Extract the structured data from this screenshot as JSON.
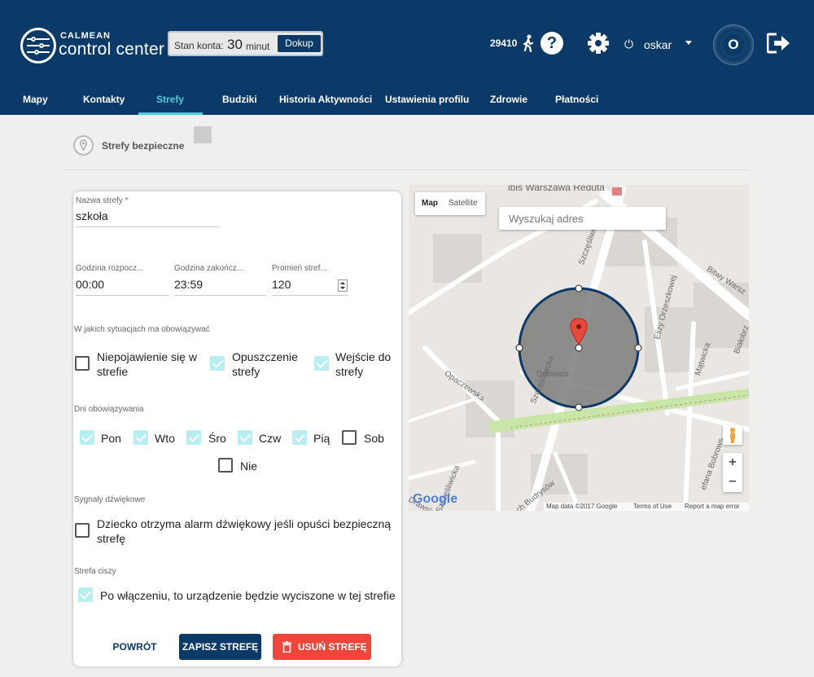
{
  "header": {
    "brand_top": "CALMEAN",
    "brand_main": "control center",
    "account_label": "Stan konta:",
    "account_value": "30",
    "account_unit": "minut",
    "topup_label": "Dokup",
    "steps": "29410",
    "user_name": "oskar",
    "avatar_letter": "O",
    "colors": {
      "background": "#0b3a68",
      "accent": "#4ecbd8"
    }
  },
  "nav": {
    "tabs": [
      "Mapy",
      "Kontakty",
      "Strefy",
      "Budziki",
      "Historia Aktywności",
      "Ustawienia profilu",
      "Zdrowie",
      "Płatności"
    ],
    "active_tab": "Strefy"
  },
  "section": {
    "title": "Strefy bezpieczne"
  },
  "form": {
    "name_label": "Nazwa strefy *",
    "name_value": "szkoła",
    "start_label": "Godzina rozpocz...",
    "start_value": "00:00",
    "end_label": "Godzina zakończ...",
    "end_value": "23:59",
    "radius_label": "Promień stref...",
    "radius_value": "120",
    "situations_title": "W jakich sytuacjach ma obowiązywać",
    "situations": [
      {
        "label": "Niepojawienie się w strefie",
        "checked": false
      },
      {
        "label": "Opuszczenie strefy",
        "checked": true
      },
      {
        "label": "Wejście do strefy",
        "checked": true
      }
    ],
    "days_title": "Dni obowiązywania",
    "days": [
      {
        "label": "Pon",
        "checked": true
      },
      {
        "label": "Wto",
        "checked": true
      },
      {
        "label": "Śro",
        "checked": true
      },
      {
        "label": "Czw",
        "checked": true
      },
      {
        "label": "Pią",
        "checked": true
      },
      {
        "label": "Sob",
        "checked": false
      },
      {
        "label": "Nie",
        "checked": false
      }
    ],
    "sound_title": "Sygnały dźwiękowe",
    "sound_label": "Dziecko otrzyma alarm dźwiękowy jeśli opuści bezpieczną strefę",
    "sound_checked": false,
    "silence_title": "Strefa ciszy",
    "silence_label": "Po włączeniu, to urządzenie będzie wyciszone w tej strefie",
    "silence_checked": true,
    "back_label": "POWRÓT",
    "save_label": "ZAPISZ STREFĘ",
    "delete_label": "USUŃ STREFĘ",
    "colors": {
      "save": "#0b3a68",
      "delete": "#f0453a",
      "checkbox_on": "#b7eef1"
    }
  },
  "map": {
    "type_map": "Map",
    "type_satellite": "Satellite",
    "search_placeholder": "Wyszukaj adres",
    "poi": "ibis Warszawa Reduta",
    "streets": [
      "Szczęśliwicka",
      "Bitwy Warsz",
      "Elizy Orzeszkowej",
      "Białobrz",
      "Mątwicka",
      "Szczęśliwicka",
      "Opaczewska",
      "Dobosza",
      "Szczęśliwicka",
      "Drawska",
      "ch Budrysów",
      "efana Bobrows"
    ],
    "zoom_in": "+",
    "zoom_out": "−",
    "google": "Google",
    "attribution": "Map data ©2017 Google",
    "terms": "Terms of Use",
    "report": "Report a map error"
  }
}
